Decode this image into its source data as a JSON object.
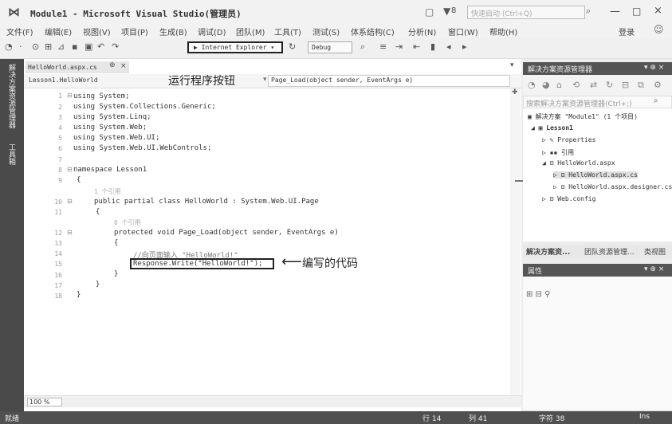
{
  "window": {
    "title": "Module1 - Microsoft Visual Studio(管理员)",
    "notification_count": "8",
    "quick_launch_placeholder": "快速启动 (Ctrl+Q)",
    "login": "登录",
    "min": "—",
    "max": "□",
    "close": "×"
  },
  "menu": [
    "文件(F)",
    "编辑(E)",
    "视图(V)",
    "项目(P)",
    "生成(B)",
    "调试(D)",
    "团队(M)",
    "工具(T)",
    "测试(S)",
    "体系结构(C)",
    "分析(N)",
    "窗口(W)",
    "帮助(H)"
  ],
  "toolbar": {
    "run_label": "▶ Internet Explorer ▾",
    "configuration": "Debug"
  },
  "left_strip": {
    "tab1": "解决方案资源管理器",
    "tab2": "工具箱"
  },
  "editor": {
    "tab_name": "HelloWorld.aspx.cs",
    "tab_pin": "⊕",
    "tab_close": "×",
    "nav_class": "Lesson1.HelloWorld",
    "nav_member": "Page_Load(object sender, EventArgs e)",
    "zoom": "100 %",
    "lines": [
      {
        "num": "1",
        "text": "using System;"
      },
      {
        "num": "2",
        "text": "using System.Collections.Generic;"
      },
      {
        "num": "3",
        "text": "using System.Linq;"
      },
      {
        "num": "4",
        "text": "using System.Web;"
      },
      {
        "num": "5",
        "text": "using System.Web.UI;"
      },
      {
        "num": "6",
        "text": "using System.Web.UI.WebControls;"
      },
      {
        "num": "7",
        "text": ""
      },
      {
        "num": "8",
        "text": "namespace Lesson1"
      },
      {
        "num": "9",
        "text": "{"
      },
      {
        "num": "",
        "text": "1 个引用"
      },
      {
        "num": "10",
        "text": "public partial class HelloWorld : System.Web.UI.Page"
      },
      {
        "num": "11",
        "text": "{"
      },
      {
        "num": "",
        "text": "0 个引用"
      },
      {
        "num": "12",
        "text": "protected void Page_Load(object sender, EventArgs e)"
      },
      {
        "num": "13",
        "text": "{"
      },
      {
        "num": "14",
        "text": "//向页面输入 \"HelloWorld!\""
      },
      {
        "num": "15",
        "text": "Response.Write(\"HelloWorld!\");"
      },
      {
        "num": "16",
        "text": "}"
      },
      {
        "num": "17",
        "text": "}"
      },
      {
        "num": "18",
        "text": "}"
      }
    ]
  },
  "annotations": {
    "run_button": "运行程序按钮",
    "code": "编写的代码"
  },
  "solution_explorer": {
    "title": "解决方案资源管理器",
    "search_placeholder": "搜索解决方案资源管理器(Ctrl+;)",
    "tree": [
      "解决方案 \"Module1\" (1 个项目)",
      "Lesson1",
      "Properties",
      "引用",
      "HelloWorld.aspx",
      "HelloWorld.aspx.cs",
      "HelloWorld.aspx.designer.cs",
      "Web.config"
    ],
    "tabs": [
      "解决方案资...",
      "团队资源管理...",
      "类视图"
    ]
  },
  "properties": {
    "title": "属性"
  },
  "status": {
    "ready": "就绪",
    "line": "行 14",
    "col": "列 41",
    "char": "字符 38",
    "ins": "Ins"
  }
}
